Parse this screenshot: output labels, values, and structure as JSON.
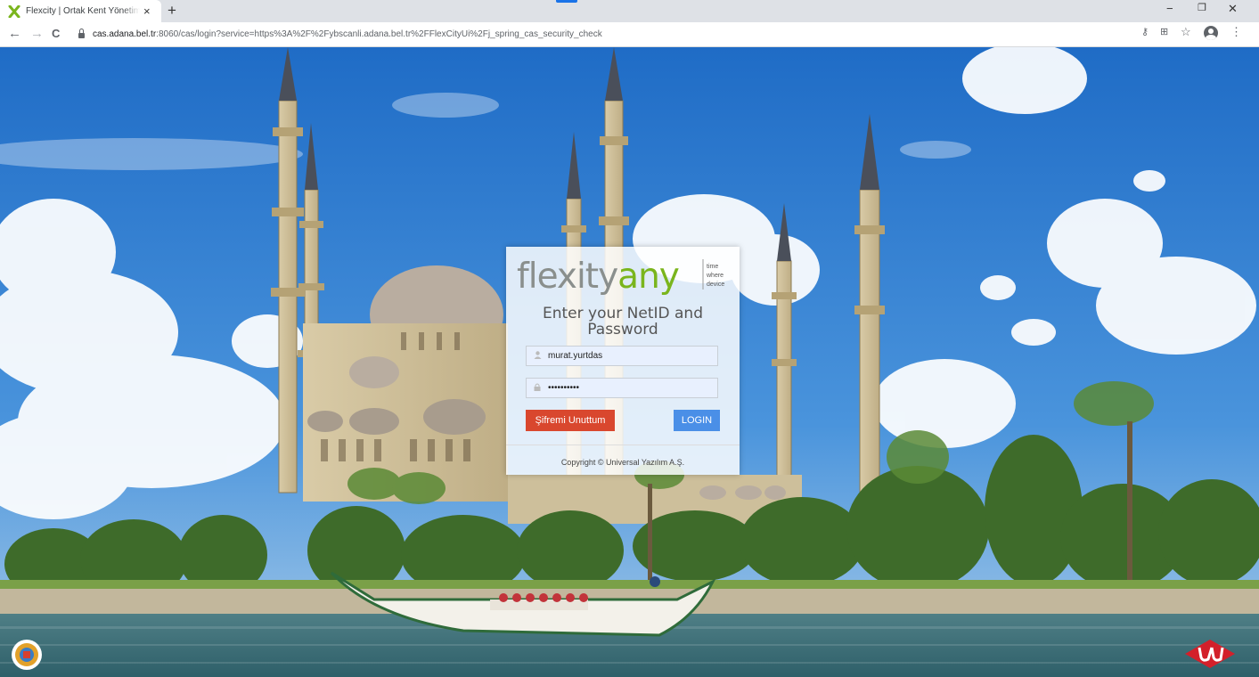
{
  "browser": {
    "tab_title": "Flexcity | Ortak Kent Yönetim Platformu",
    "new_tab_glyph": "+",
    "close_tab_glyph": "×",
    "url_host": "cas.adana.bel.tr",
    "url_rest": ":8060/cas/login?service=https%3A%2F%2Fybscanli.adana.bel.tr%2FFlexCityUi%2Fj_spring_cas_security_check",
    "back_glyph": "←",
    "forward_glyph": "→",
    "reload_glyph": "C",
    "minimize_glyph": "−",
    "restore_glyph": "❐",
    "close_glyph": "✕",
    "menu_glyph": "⋮",
    "star_glyph": "☆",
    "key_glyph": "⚷",
    "translate_glyph": "⊞"
  },
  "login": {
    "logo_main": "flexityany",
    "logo_tagline": [
      "time",
      "where",
      "device"
    ],
    "heading_line1": "Enter your NetID and",
    "heading_line2": "Password",
    "username_value": "murat.yurtdas",
    "password_value": "••••••••••",
    "forgot_label": "Şifremi Unuttum",
    "login_label": "LOGIN",
    "copyright": "Copyright © Universal Yazılım A.Ş."
  },
  "colors": {
    "logo_gray": "#8a8f8d",
    "logo_green": "#7ab51d",
    "forgot_red": "#d9472e",
    "login_blue": "#4a8fe7",
    "sky": "#2f7bd1"
  }
}
